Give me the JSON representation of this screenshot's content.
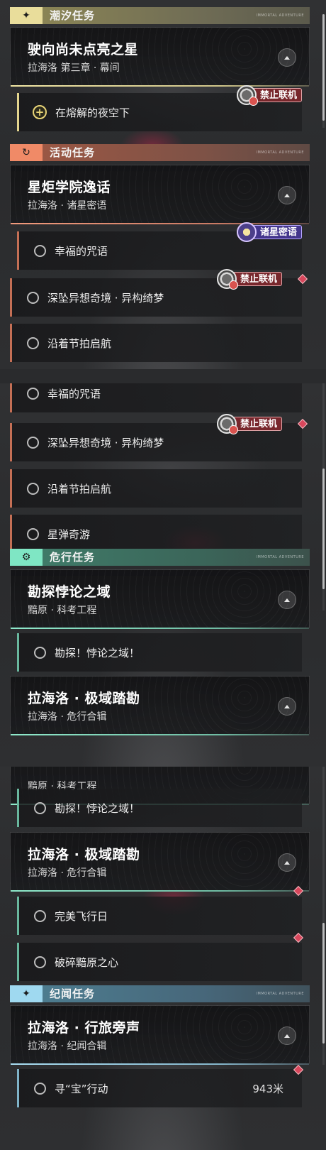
{
  "sections": {
    "tide": {
      "label": "潮汐任务",
      "tag": "IMMORTAL ADVENTURE",
      "color": "#e9dd9b"
    },
    "event": {
      "label": "活动任务",
      "tag": "IMMORTAL ADVENTURE",
      "color": "#f08a67"
    },
    "danger": {
      "label": "危行任务",
      "tag": "IMMORTAL ADVENTURE",
      "color": "#7fe6c4"
    },
    "lore": {
      "label": "纪闻任务",
      "tag": "IMMORTAL ADVENTURE",
      "color": "#9fd9f0"
    }
  },
  "quests": {
    "star": {
      "title": "驶向尚未点亮之星",
      "subtitle": "拉海洛 第三章 · 幕间"
    },
    "academy": {
      "title": "星炬学院逸话",
      "subtitle": "拉海洛 · 诸星密语"
    },
    "paradox": {
      "title": "勘探悖论之域",
      "subtitle": "黯原 · 科考工程"
    },
    "polar": {
      "title": "拉海洛 · 极域踏勘",
      "subtitle": "拉海洛 · 危行合辑"
    },
    "voices": {
      "title": "拉海洛 · 行旅旁声",
      "subtitle": "拉海洛 · 纪闻合辑"
    }
  },
  "steps": {
    "night_sky": "在熔解的夜空下",
    "happy_spell": "幸福的咒语",
    "deep_dream": "深坠异想奇境 · 异构绮梦",
    "rhythm_sail": "沿着节拍启航",
    "star_bullet": "星弹奇游",
    "explore_paradox": "勘探！悖论之域！",
    "flight_day": "完美飞行日",
    "shatter_heart": "破碎黯原之心",
    "treasure_hunt": "寻“宝”行动",
    "treasure_distance": "943米"
  },
  "badges": {
    "no_coop": "禁止联机",
    "star_whisper": "诸星密语"
  },
  "icons": {
    "tide": "sparkle-icon",
    "event": "refresh-icon",
    "danger": "gear-icon",
    "lore": "sparkle-icon",
    "toggle": "caret-up-icon"
  }
}
